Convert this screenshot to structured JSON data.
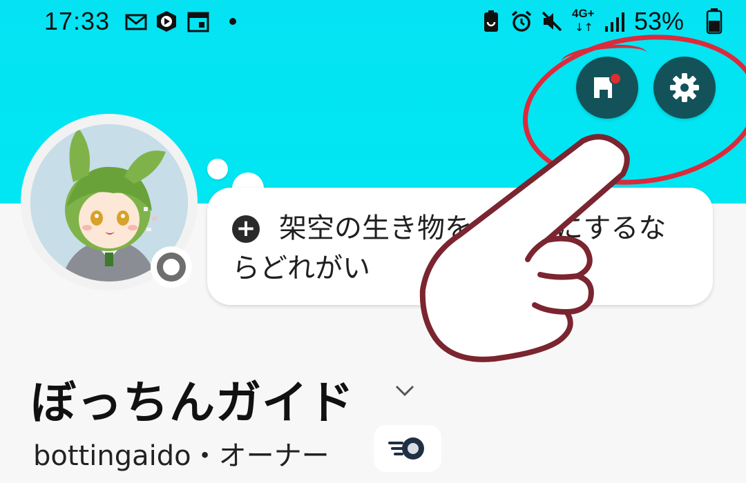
{
  "status_bar": {
    "time": "17:33",
    "network": "4G+",
    "battery_percent": "53%",
    "icons": [
      "mail-icon",
      "play-app-icon",
      "calendar-icon",
      "dot-icon",
      "battery-saver-icon",
      "alarm-icon",
      "mute-icon",
      "network-4g-icon",
      "signal-icon",
      "battery-icon"
    ]
  },
  "header": {
    "accent_color": "#00e6f2",
    "buttons": [
      {
        "icon": "shop-icon",
        "badge": "red-dot"
      },
      {
        "icon": "gear-icon"
      }
    ]
  },
  "profile": {
    "note": "架空の生き物をペットにするならどれがい",
    "name": "ぼっちんガイド",
    "handle_line": "bottingaido・オーナー"
  },
  "colors": {
    "button_bg": "#14525a",
    "annotation_red": "#dc2a3b",
    "hand_outline": "#7a2530"
  }
}
